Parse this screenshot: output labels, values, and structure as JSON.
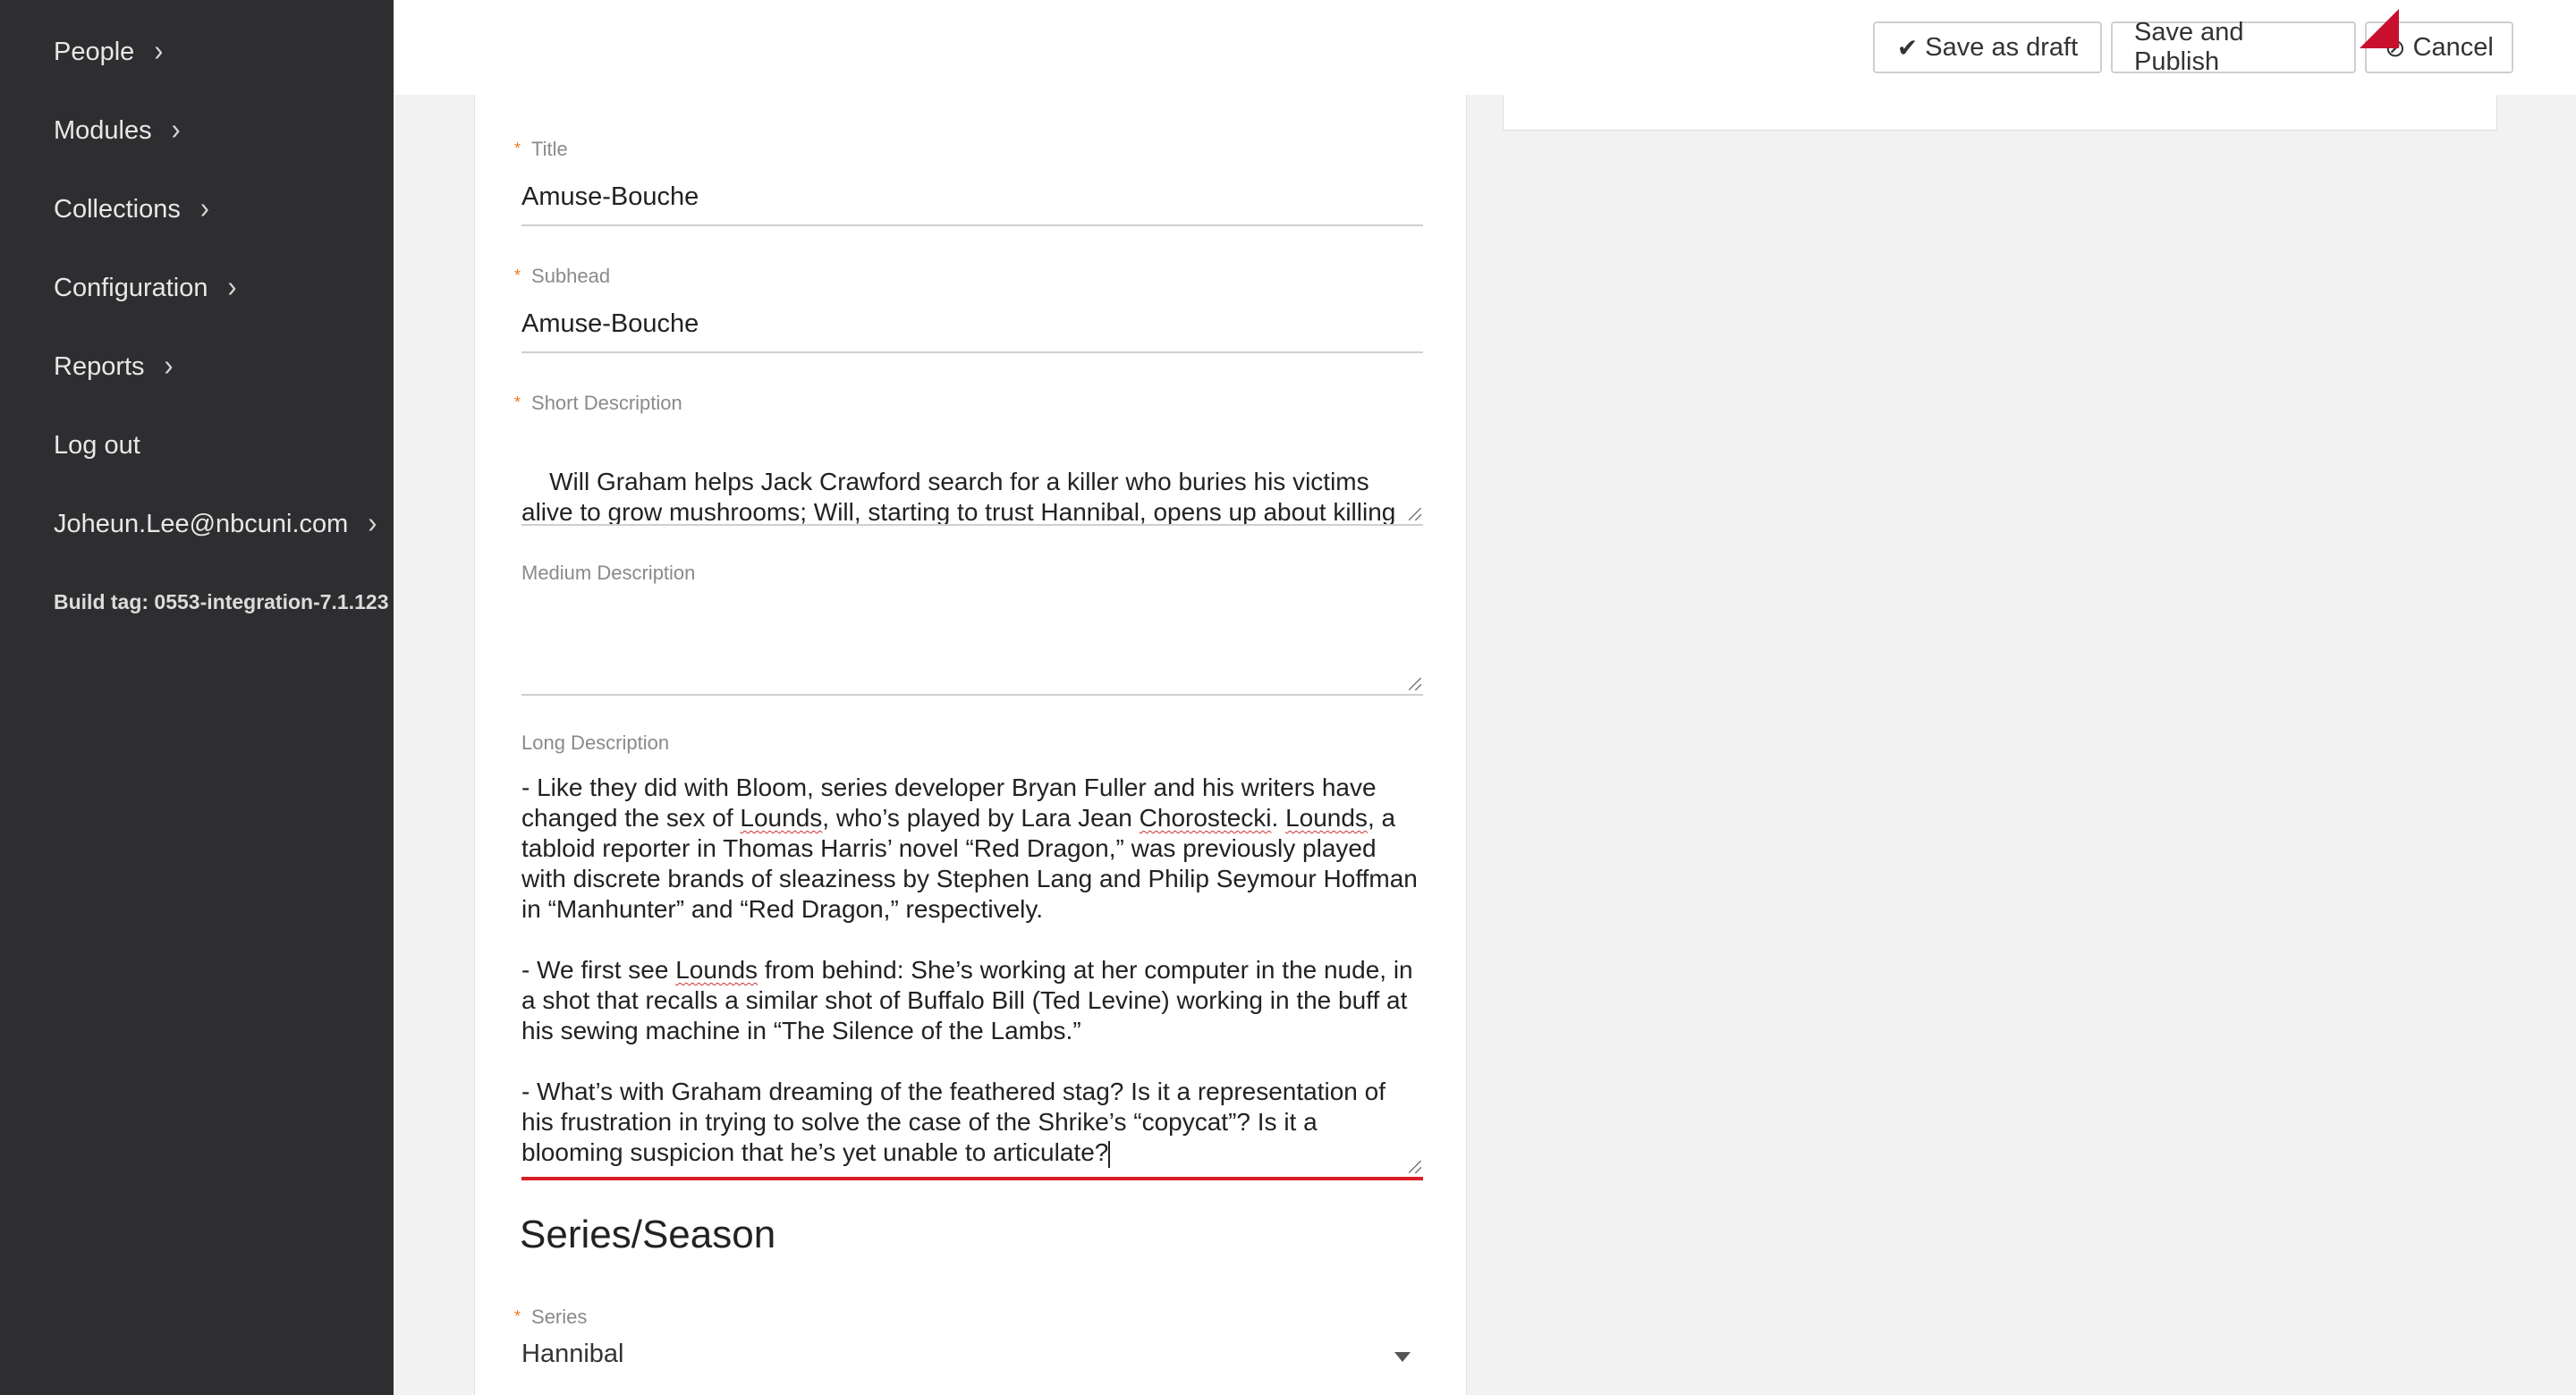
{
  "sidebar": {
    "items": [
      {
        "label": "People",
        "chevron": "›"
      },
      {
        "label": "Modules",
        "chevron": "›"
      },
      {
        "label": "Collections",
        "chevron": "›"
      },
      {
        "label": "Configuration",
        "chevron": "›"
      },
      {
        "label": "Reports",
        "chevron": "›"
      },
      {
        "label": "Log out"
      },
      {
        "label": "Joheun.Lee@nbcuni.com",
        "chevron": "›"
      }
    ],
    "build_tag": "Build tag: 0553-integration-7.1.123"
  },
  "toolbar": {
    "save_draft_label": "Save as draft",
    "save_draft_icon": "✔",
    "save_publish_label": "Save and Publish",
    "cancel_label": "Cancel",
    "cancel_icon": "⊘"
  },
  "form": {
    "required_mark": "*",
    "title": {
      "label": "Title",
      "value": "Amuse-Bouche"
    },
    "subhead": {
      "label": "Subhead",
      "value": "Amuse-Bouche"
    },
    "short_description": {
      "label": "Short Description",
      "value": "Will Graham helps Jack Crawford search for a killer who buries his victims alive to grow mushrooms; Will, starting to trust Hannibal, opens up about killing Hobbs; Freddie Lounds lurks around the investigation."
    },
    "medium_description": {
      "label": "Medium Description",
      "value": ""
    },
    "long_description": {
      "label": "Long Description",
      "p1_a": "- Like they did with Bloom, series developer Bryan Fuller and his writers have changed the sex of ",
      "w_lounds1": "Lounds",
      "p1_b": ", who’s played by Lara Jean ",
      "w_choro": "Chorostecki",
      "p1_c": ". ",
      "w_lounds2": "Lounds",
      "p1_d": ", a tabloid reporter in Thomas Harris’ novel “Red Dragon,” was previously played with discrete brands of sleaziness by Stephen Lang and Philip Seymour Hoffman in “Manhunter” and “Red Dragon,” respectively.",
      "p2_a": "- We first see ",
      "w_lounds3": "Lounds",
      "p2_b": " from behind: She’s working at her computer in the nude, in a shot that recalls a similar shot of Buffalo Bill (Ted Levine) working in the buff at his sewing machine in “The Silence of the Lambs.”",
      "p3": "- What’s with Graham dreaming of the feathered stag? Is it a representation of his frustration in trying to solve the case of the Shrike’s “copycat”? Is it a blooming suspicion that he’s yet unable to articulate?"
    },
    "section_heading": "Series/Season",
    "series": {
      "label": "Series",
      "value": "Hannibal"
    }
  },
  "colors": {
    "sidebar_bg": "#2e2e31",
    "required_star": "#e87722",
    "active_underline": "#d81f26",
    "pointer_marker": "#c8102e"
  }
}
